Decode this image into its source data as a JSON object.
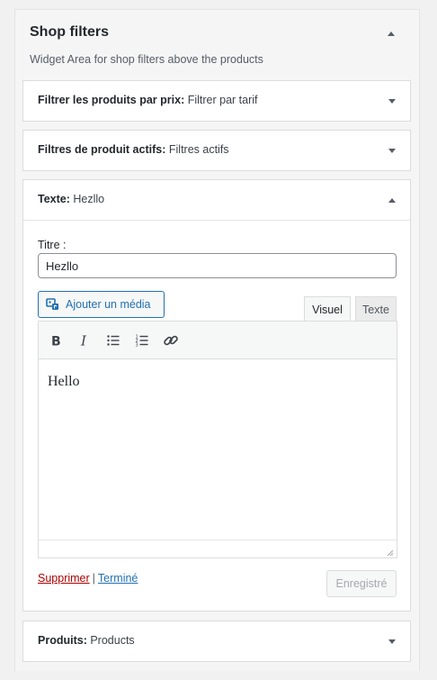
{
  "panel": {
    "title": "Shop filters",
    "description": "Widget Area for shop filters above the products"
  },
  "widgets": [
    {
      "type_label": "Filtrer les produits par prix:",
      "instance_title": "Filtrer par tarif",
      "state": "collapsed"
    },
    {
      "type_label": "Filtres de produit actifs:",
      "instance_title": "Filtres actifs",
      "state": "collapsed"
    },
    {
      "type_label": "Texte:",
      "instance_title": "Hezllo",
      "state": "expanded"
    },
    {
      "type_label": "Produits:",
      "instance_title": "Products",
      "state": "collapsed"
    }
  ],
  "text_widget": {
    "title_label": "Titre :",
    "title_value": "Hezllo",
    "add_media_label": "Ajouter un média",
    "tabs": {
      "visual": "Visuel",
      "text": "Texte"
    },
    "active_tab": "Visuel",
    "toolbar": [
      "bold-icon",
      "italic-icon",
      "bullet-list-icon",
      "numbered-list-icon",
      "link-icon"
    ],
    "content": "Hello",
    "delete_label": "Supprimer",
    "separator": "|",
    "done_label": "Terminé",
    "save_label": "Enregistré"
  },
  "colors": {
    "link": "#2271b1",
    "delete_link": "#a00",
    "disabled_text": "#a7aaad"
  }
}
